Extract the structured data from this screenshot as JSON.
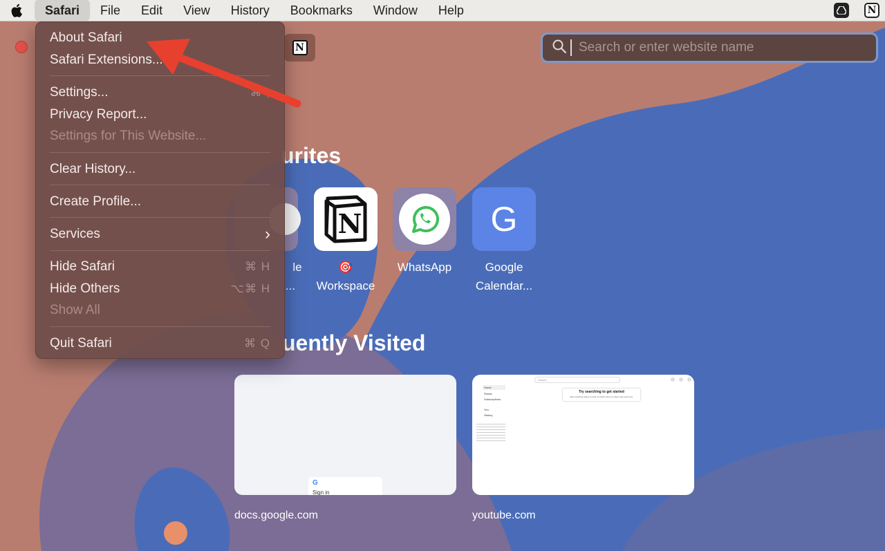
{
  "menubar": {
    "apple_icon": "apple-logo-icon",
    "items": [
      "Safari",
      "File",
      "Edit",
      "View",
      "History",
      "Bookmarks",
      "Window",
      "Help"
    ],
    "status_icons": [
      "google-drive-icon",
      "notion-icon"
    ],
    "notion_letter": "N"
  },
  "tabbar": {
    "notion_tab_letter": "N"
  },
  "search": {
    "placeholder": "Search or enter website name"
  },
  "favourites": {
    "title_visible": "urites",
    "items": [
      {
        "icon": "notion-icon",
        "letter": "N",
        "label_line1": "🎯",
        "label_line2": "Workspace"
      },
      {
        "icon": "whatsapp-icon",
        "label_line1": "WhatsApp",
        "label_line2": ""
      },
      {
        "icon": "google-icon",
        "letter": "G",
        "label_line1": "Google",
        "label_line2": "Calendar..."
      }
    ],
    "partial_label_1": "le",
    "partial_label_2": "..."
  },
  "frequently_visited": {
    "title_visible": "uently Visited",
    "items": [
      {
        "label": "docs.google.com",
        "preview_text": "Sign in"
      },
      {
        "label": "youtube.com",
        "preview_search": "Search",
        "preview_title": "Try searching to get started",
        "preview_sub": "Start watching videos to help us build a feed of videos that you'll love.",
        "preview_nav": [
          "Home",
          "Shorts",
          "Subscriptions",
          "You",
          "History"
        ]
      }
    ]
  },
  "safari_menu": {
    "items": [
      {
        "label": "About Safari",
        "shortcut": "",
        "disabled": false
      },
      {
        "label": "Safari Extensions...",
        "shortcut": "",
        "disabled": false
      },
      {
        "label": "Settings...",
        "shortcut": "⌘ ,",
        "disabled": false
      },
      {
        "label": "Privacy Report...",
        "shortcut": "",
        "disabled": false
      },
      {
        "label": "Settings for This Website...",
        "shortcut": "",
        "disabled": true
      },
      {
        "label": "Clear History...",
        "shortcut": "",
        "disabled": false
      },
      {
        "label": "Create Profile...",
        "shortcut": "",
        "disabled": false
      },
      {
        "label": "Services",
        "shortcut": "›",
        "disabled": false
      },
      {
        "label": "Hide Safari",
        "shortcut": "⌘ H",
        "disabled": false
      },
      {
        "label": "Hide Others",
        "shortcut": "⌥⌘ H",
        "disabled": false
      },
      {
        "label": "Show All",
        "shortcut": "",
        "disabled": true
      },
      {
        "label": "Quit Safari",
        "shortcut": "⌘ Q",
        "disabled": false
      }
    ]
  },
  "colors": {
    "wallpaper_blue": "#4a6cb8",
    "wallpaper_terracotta": "#b97d70",
    "menu_bg": "#704e4a",
    "annotation_arrow": "#e8402f",
    "close_button": "#e5514b"
  }
}
